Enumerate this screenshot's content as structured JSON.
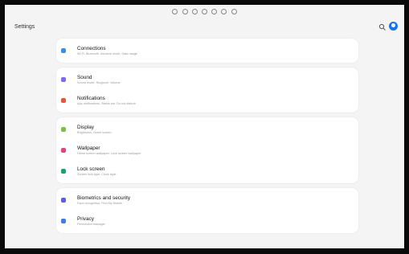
{
  "header": {
    "title": "Settings"
  },
  "status_icons": [
    "notification-icon",
    "notification-icon",
    "notification-icon",
    "alert-icon",
    "gear-icon",
    "play-icon",
    "grid-icon"
  ],
  "colors": {
    "accent": "#1a73e8",
    "background": "#f4f4f5",
    "card": "#ffffff"
  },
  "groups": [
    [
      {
        "label": "Connections",
        "sub": "Wi-Fi, Bluetooth, Airplane mode, Data usage",
        "icon": "wifi-icon",
        "color": "#3c8cf0"
      }
    ],
    [
      {
        "label": "Sound",
        "sub": "Sound mode, Ringtone, Volume",
        "icon": "speaker-icon",
        "color": "#7a6cf0"
      },
      {
        "label": "Notifications",
        "sub": "App notifications, Status bar, Do not disturb",
        "icon": "bell-icon",
        "color": "#e8553d"
      }
    ],
    [
      {
        "label": "Display",
        "sub": "Brightness, Home screen",
        "icon": "sun-icon",
        "color": "#7bc043"
      },
      {
        "label": "Wallpaper",
        "sub": "Home screen wallpaper, Lock screen wallpaper",
        "icon": "image-icon",
        "color": "#e0457b"
      },
      {
        "label": "Lock screen",
        "sub": "Screen lock type, Clock style",
        "icon": "lock-icon",
        "color": "#1aa36b"
      }
    ],
    [
      {
        "label": "Biometrics and security",
        "sub": "Face recognition, Find My Mobile",
        "icon": "shield-icon",
        "color": "#5b5de8"
      },
      {
        "label": "Privacy",
        "sub": "Permission manager",
        "icon": "privacy-icon",
        "color": "#3f7de8"
      }
    ]
  ]
}
